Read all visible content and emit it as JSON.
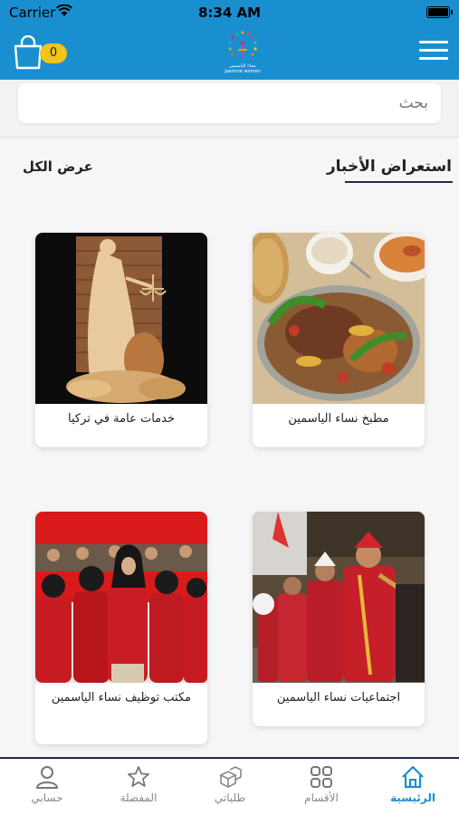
{
  "status_bar": {
    "carrier": "Carrier",
    "time": "8:34 AM"
  },
  "header": {
    "cart_count": "0",
    "logo_caption_ar": "نساء الياسمين",
    "logo_caption_en": "Jasmine women"
  },
  "search": {
    "placeholder": "بحث"
  },
  "news": {
    "title": "استعراض الأخبار",
    "view_all": "عرض الكل",
    "items": [
      {
        "title": "مطبخ نساء الياسمين"
      },
      {
        "title": "خدمات عامة في تركيا"
      },
      {
        "title": "اجتماعيات نساء الياسمين"
      },
      {
        "title": "مكتب توظيف نساء الياسمين"
      }
    ]
  },
  "tabs": [
    {
      "label": "الرئيسية",
      "icon": "home-icon",
      "active": true
    },
    {
      "label": "الأقسام",
      "icon": "grid-icon",
      "active": false
    },
    {
      "label": "طلباتي",
      "icon": "boxes-icon",
      "active": false
    },
    {
      "label": "المفضلة",
      "icon": "star-icon",
      "active": false
    },
    {
      "label": "حسابي",
      "icon": "user-icon",
      "active": false
    }
  ],
  "colors": {
    "brand": "#1a8fd0",
    "badge": "#f0c418",
    "accent_line": "#1b2b4a"
  }
}
